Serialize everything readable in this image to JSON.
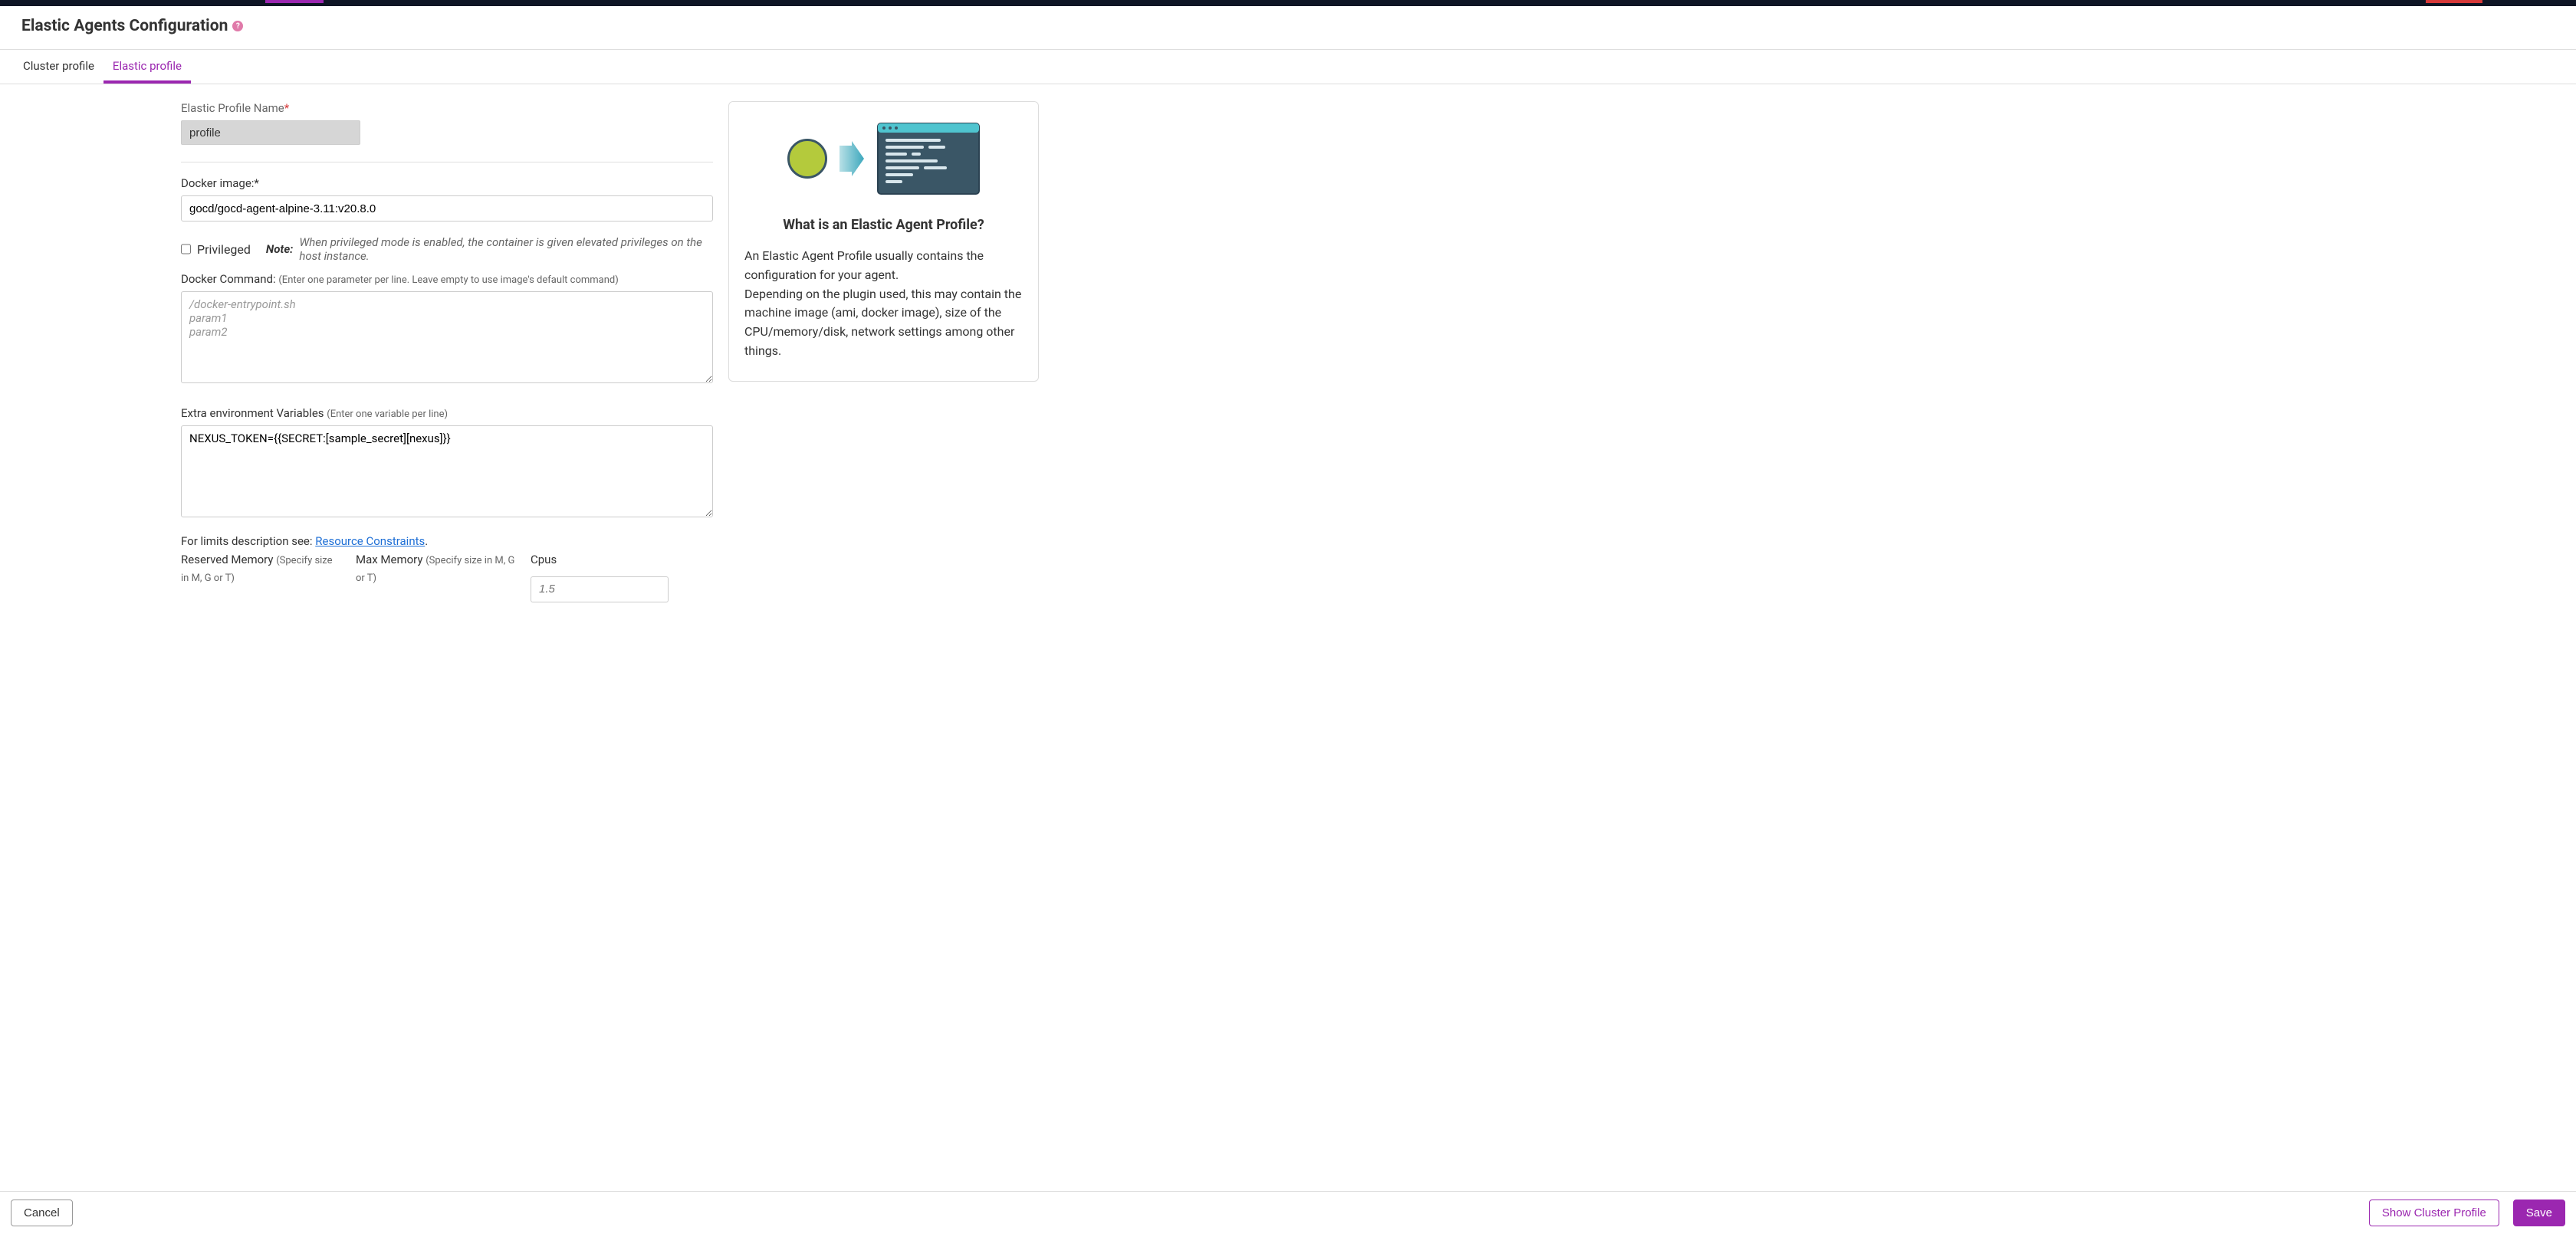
{
  "header": {
    "title": "Elastic Agents Configuration"
  },
  "tabs": {
    "cluster": "Cluster profile",
    "elastic": "Elastic profile"
  },
  "form": {
    "profileName": {
      "label": "Elastic Profile Name",
      "value": "profile"
    },
    "dockerImage": {
      "label": "Docker image:*",
      "value": "gocd/gocd-agent-alpine-3.11:v20.8.0"
    },
    "privileged": {
      "label": "Privileged",
      "noteLabel": "Note:",
      "noteText": "When privileged mode is enabled, the container is given elevated privileges on the host instance."
    },
    "dockerCommand": {
      "label": "Docker Command: ",
      "hint": "(Enter one parameter per line. Leave empty to use image's default command)",
      "placeholder": "/docker-entrypoint.sh\nparam1\nparam2",
      "value": ""
    },
    "envVars": {
      "label": "Extra environment Variables ",
      "hint": "(Enter one variable per line)",
      "value": "NEXUS_TOKEN={{SECRET:[sample_secret][nexus]}}"
    },
    "limits": {
      "description": "For limits description see: ",
      "linkText": "Resource Constraints",
      "period": ".",
      "reservedMemory": {
        "label": "Reserved Memory ",
        "hint": "(Specify size in M, G or T)"
      },
      "maxMemory": {
        "label": "Max Memory ",
        "hint": "(Specify size in M, G or T)"
      },
      "cpus": {
        "label": "Cpus",
        "placeholder": "1.5"
      }
    }
  },
  "info": {
    "title": "What is an Elastic Agent Profile?",
    "p1": "An Elastic Agent Profile usually contains the configuration for your agent.",
    "p2": "Depending on the plugin used, this may contain the machine image (ami, docker image), size of the CPU/memory/disk, network settings among other things."
  },
  "footer": {
    "cancel": "Cancel",
    "showCluster": "Show Cluster Profile",
    "save": "Save"
  }
}
